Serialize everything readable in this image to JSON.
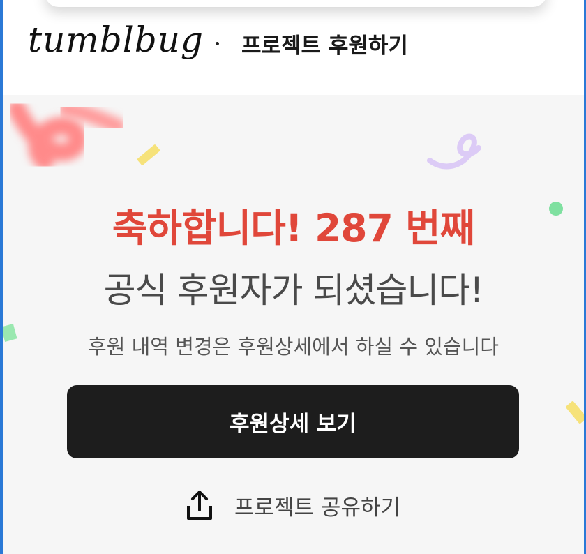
{
  "header": {
    "logo_text": "tumblbug",
    "separator": "·",
    "title": "프로젝트 후원하기"
  },
  "main": {
    "headline": "축하합니다! 287 번째",
    "subheadline": "공식 후원자가 되셨습니다!",
    "note": "후원 내역 변경은 후원상세에서 하실 수 있습니다",
    "primary_button_label": "후원상세 보기",
    "share_label": "프로젝트 공유하기"
  },
  "colors": {
    "accent_red": "#e0473a",
    "button_bg": "#1d1d1d",
    "confetti_yellow": "#f6e27a",
    "confetti_green": "#7fe0a0",
    "confetti_purple": "#d9c8f5",
    "confetti_pink": "#ff8a8a"
  },
  "icons": {
    "share": "share-upload-icon"
  }
}
